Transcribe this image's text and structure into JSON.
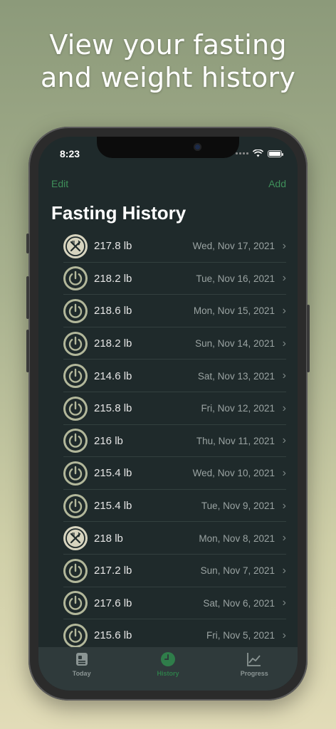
{
  "headline": {
    "line1": "View your fasting",
    "line2": "and weight history"
  },
  "status_bar": {
    "time": "8:23"
  },
  "nav": {
    "edit_label": "Edit",
    "add_label": "Add",
    "title": "Fasting History"
  },
  "entries": [
    {
      "weight": "217.8 lb",
      "date": "Wed, Nov 17, 2021",
      "icon": "fork-knife-crossed-icon"
    },
    {
      "weight": "218.2 lb",
      "date": "Tue, Nov 16, 2021",
      "icon": "power-icon"
    },
    {
      "weight": "218.6 lb",
      "date": "Mon, Nov 15, 2021",
      "icon": "power-icon"
    },
    {
      "weight": "218.2 lb",
      "date": "Sun, Nov 14, 2021",
      "icon": "power-icon"
    },
    {
      "weight": "214.6 lb",
      "date": "Sat, Nov 13, 2021",
      "icon": "power-icon"
    },
    {
      "weight": "215.8 lb",
      "date": "Fri, Nov 12, 2021",
      "icon": "power-icon"
    },
    {
      "weight": "216 lb",
      "date": "Thu, Nov 11, 2021",
      "icon": "power-icon"
    },
    {
      "weight": "215.4 lb",
      "date": "Wed, Nov 10, 2021",
      "icon": "power-icon"
    },
    {
      "weight": "215.4 lb",
      "date": "Tue, Nov 9, 2021",
      "icon": "power-icon"
    },
    {
      "weight": "218 lb",
      "date": "Mon, Nov 8, 2021",
      "icon": "fork-knife-crossed-icon"
    },
    {
      "weight": "217.2 lb",
      "date": "Sun, Nov 7, 2021",
      "icon": "power-icon"
    },
    {
      "weight": "217.6 lb",
      "date": "Sat, Nov 6, 2021",
      "icon": "power-icon"
    },
    {
      "weight": "215.6 lb",
      "date": "Fri, Nov 5, 2021",
      "icon": "power-icon"
    }
  ],
  "tabs": [
    {
      "label": "Today",
      "icon": "today-icon",
      "active": false
    },
    {
      "label": "History",
      "icon": "history-clock-icon",
      "active": true
    },
    {
      "label": "Progress",
      "icon": "progress-chart-icon",
      "active": false
    }
  ],
  "colors": {
    "accent_green": "#3f8f5a",
    "screen_bg": "#1f2a2b",
    "tab_bar_bg": "#2f3a3b"
  }
}
